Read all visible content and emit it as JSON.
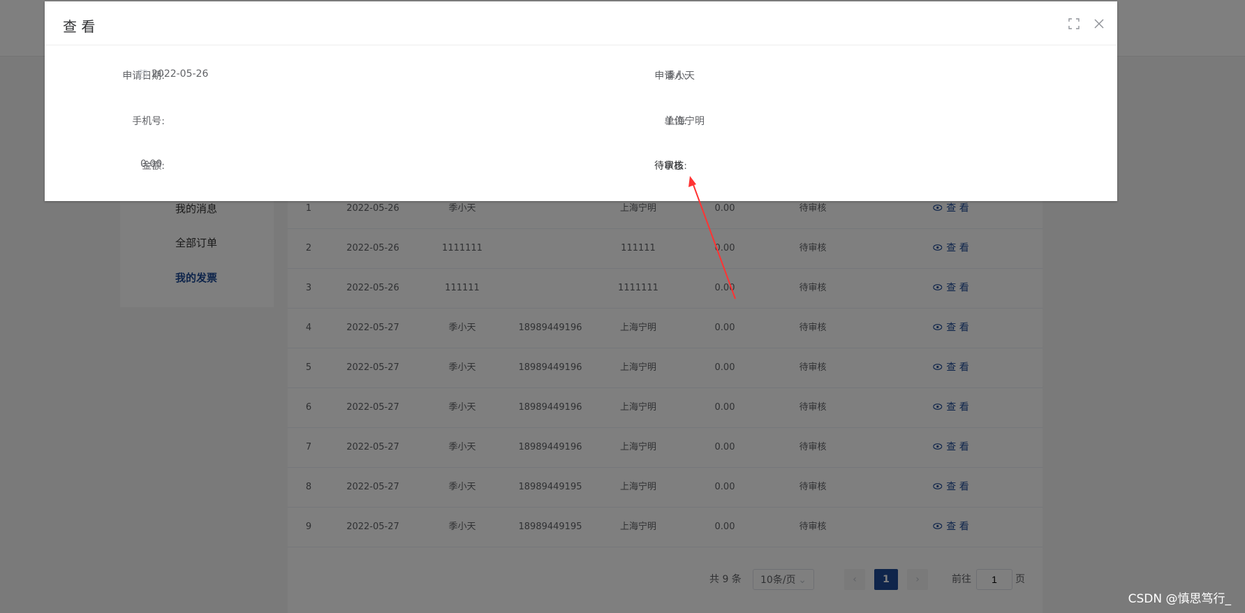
{
  "sidebar": {
    "items": [
      {
        "label": "我的消息"
      },
      {
        "label": "全部订单"
      },
      {
        "label": "我的发票"
      }
    ]
  },
  "table": {
    "rows": [
      {
        "no": "1",
        "date": "2022-05-26",
        "name": "季小天",
        "phone": "",
        "company": "上海宁明",
        "amount": "0.00",
        "status": "待审核",
        "action": "查 看"
      },
      {
        "no": "2",
        "date": "2022-05-26",
        "name": "1111111",
        "phone": "",
        "company": "111111",
        "amount": "0.00",
        "status": "待审核",
        "action": "查 看"
      },
      {
        "no": "3",
        "date": "2022-05-26",
        "name": "111111",
        "phone": "",
        "company": "1111111",
        "amount": "0.00",
        "status": "待审核",
        "action": "查 看"
      },
      {
        "no": "4",
        "date": "2022-05-27",
        "name": "季小天",
        "phone": "18989449196",
        "company": "上海宁明",
        "amount": "0.00",
        "status": "待审核",
        "action": "查 看"
      },
      {
        "no": "5",
        "date": "2022-05-27",
        "name": "季小天",
        "phone": "18989449196",
        "company": "上海宁明",
        "amount": "0.00",
        "status": "待审核",
        "action": "查 看"
      },
      {
        "no": "6",
        "date": "2022-05-27",
        "name": "季小天",
        "phone": "18989449196",
        "company": "上海宁明",
        "amount": "0.00",
        "status": "待审核",
        "action": "查 看"
      },
      {
        "no": "7",
        "date": "2022-05-27",
        "name": "季小天",
        "phone": "18989449196",
        "company": "上海宁明",
        "amount": "0.00",
        "status": "待审核",
        "action": "查 看"
      },
      {
        "no": "8",
        "date": "2022-05-27",
        "name": "季小天",
        "phone": "18989449195",
        "company": "上海宁明",
        "amount": "0.00",
        "status": "待审核",
        "action": "查 看"
      },
      {
        "no": "9",
        "date": "2022-05-27",
        "name": "季小天",
        "phone": "18989449195",
        "company": "上海宁明",
        "amount": "0.00",
        "status": "待审核",
        "action": "查 看"
      }
    ]
  },
  "pagination": {
    "total": "共 9 条",
    "page_size": "10条/页",
    "current_page": "1",
    "goto_label": "前往",
    "goto_value": "1",
    "page_suffix": "页"
  },
  "dialog": {
    "title": "查 看",
    "fields": {
      "apply_date_label": "申请日期:",
      "apply_date_value": "2022-05-26",
      "applicant_label": "申请人:",
      "applicant_value": "季小天",
      "phone_label": "手机号:",
      "phone_value": "",
      "company_label": "单位:",
      "company_value": "上海宁明",
      "amount_label": "金额:",
      "amount_value": "0.00",
      "status_label": "状态:",
      "status_value": "待审核"
    }
  },
  "colors": {
    "accent": "#1e4b96",
    "annotation_arrow": "#ff3333"
  },
  "watermark": "CSDN @慎思笃行_"
}
